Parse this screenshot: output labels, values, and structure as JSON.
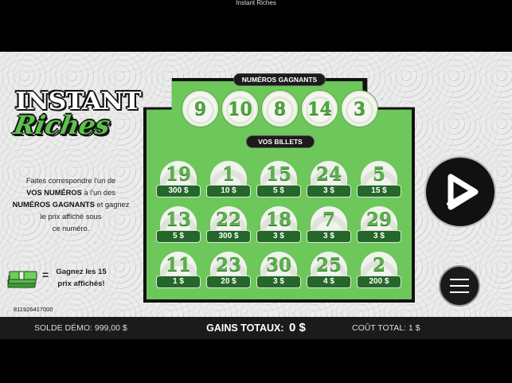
{
  "window": {
    "title": "Instant Riches"
  },
  "logo": {
    "line1": "INSTANT",
    "line2": "Riches"
  },
  "instructions": {
    "t1": "Faites correspondre l'un de",
    "b1": "VOS NUMÉROS",
    "t2": " à l'un des",
    "b2": "NUMÉROS GAGNANTS",
    "t3": " et gagnez",
    "t4": "le prix affiché sous",
    "t5": "ce numéro."
  },
  "prize_note": {
    "line1": "Gagnez les 15",
    "line2": "prix affichés!",
    "equals": "="
  },
  "serial": "811926417000",
  "board": {
    "winning_label": "NUMÉROS GAGNANTS",
    "tickets_label": "VOS BILLETS",
    "winning_numbers": [
      "9",
      "10",
      "8",
      "14",
      "3"
    ],
    "tickets": [
      {
        "number": "19",
        "prize": "300 $"
      },
      {
        "number": "1",
        "prize": "10 $"
      },
      {
        "number": "15",
        "prize": "5 $"
      },
      {
        "number": "24",
        "prize": "3 $"
      },
      {
        "number": "5",
        "prize": "15 $"
      },
      {
        "number": "13",
        "prize": "5 $"
      },
      {
        "number": "22",
        "prize": "300 $"
      },
      {
        "number": "18",
        "prize": "3 $"
      },
      {
        "number": "7",
        "prize": "3 $"
      },
      {
        "number": "29",
        "prize": "3 $"
      },
      {
        "number": "11",
        "prize": "1 $"
      },
      {
        "number": "23",
        "prize": "20 $"
      },
      {
        "number": "30",
        "prize": "3 $"
      },
      {
        "number": "25",
        "prize": "4 $"
      },
      {
        "number": "2",
        "prize": "200 $"
      }
    ]
  },
  "controls": {
    "play_icon": "play-icon",
    "menu_icon": "hamburger-menu-icon"
  },
  "status": {
    "demo_balance": "SOLDE DÉMO: 999,00 $",
    "total_win_label": "GAINS TOTAUX:",
    "total_win_amount": "0 $",
    "total_cost": "COÛT TOTAL: 1 $"
  },
  "colors": {
    "board_green": "#6dc75a",
    "prize_green": "#25662a",
    "number_green": "#5ab14b"
  }
}
